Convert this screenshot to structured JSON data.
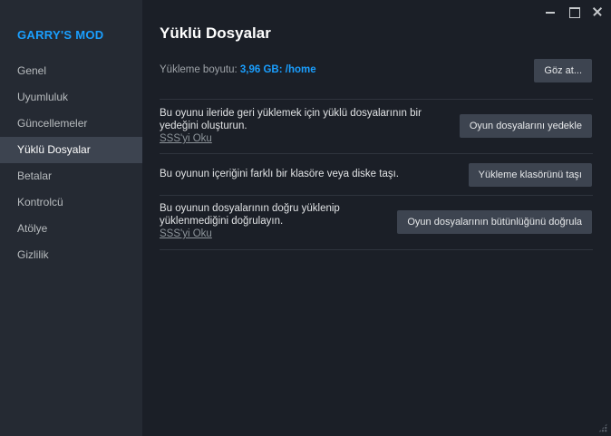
{
  "sidebar": {
    "game_title": "GARRY'S MOD",
    "items": [
      {
        "label": "Genel"
      },
      {
        "label": "Uyumluluk"
      },
      {
        "label": "Güncellemeler"
      },
      {
        "label": "Yüklü Dosyalar",
        "active": true
      },
      {
        "label": "Betalar"
      },
      {
        "label": "Kontrolcü"
      },
      {
        "label": "Atölye"
      },
      {
        "label": "Gizlilik"
      }
    ]
  },
  "main": {
    "title": "Yüklü Dosyalar",
    "install_size": {
      "label": "Yükleme boyutu:",
      "value": "3,96 GB:",
      "path": "/home",
      "browse_button": "Göz at..."
    },
    "rows": [
      {
        "text": "Bu oyunu ileride geri yüklemek için yüklü dosyalarının bir yedeğini oluşturun.",
        "link": "SSS'yi Oku",
        "button": "Oyun dosyalarını yedekle"
      },
      {
        "text": "Bu oyunun içeriğini farklı bir klasöre veya diske taşı.",
        "button": "Yükleme klasörünü taşı"
      },
      {
        "text": "Bu oyunun dosyalarının doğru yüklenip yüklenmediğini doğrulayın.",
        "link": "SSS'yi Oku",
        "button": "Oyun dosyalarının bütünlüğünü doğrula"
      }
    ]
  },
  "colors": {
    "accent": "#1a9fff",
    "sidebar_bg": "#252a33",
    "main_bg": "#1b1f27",
    "button_bg": "#3d4450"
  }
}
